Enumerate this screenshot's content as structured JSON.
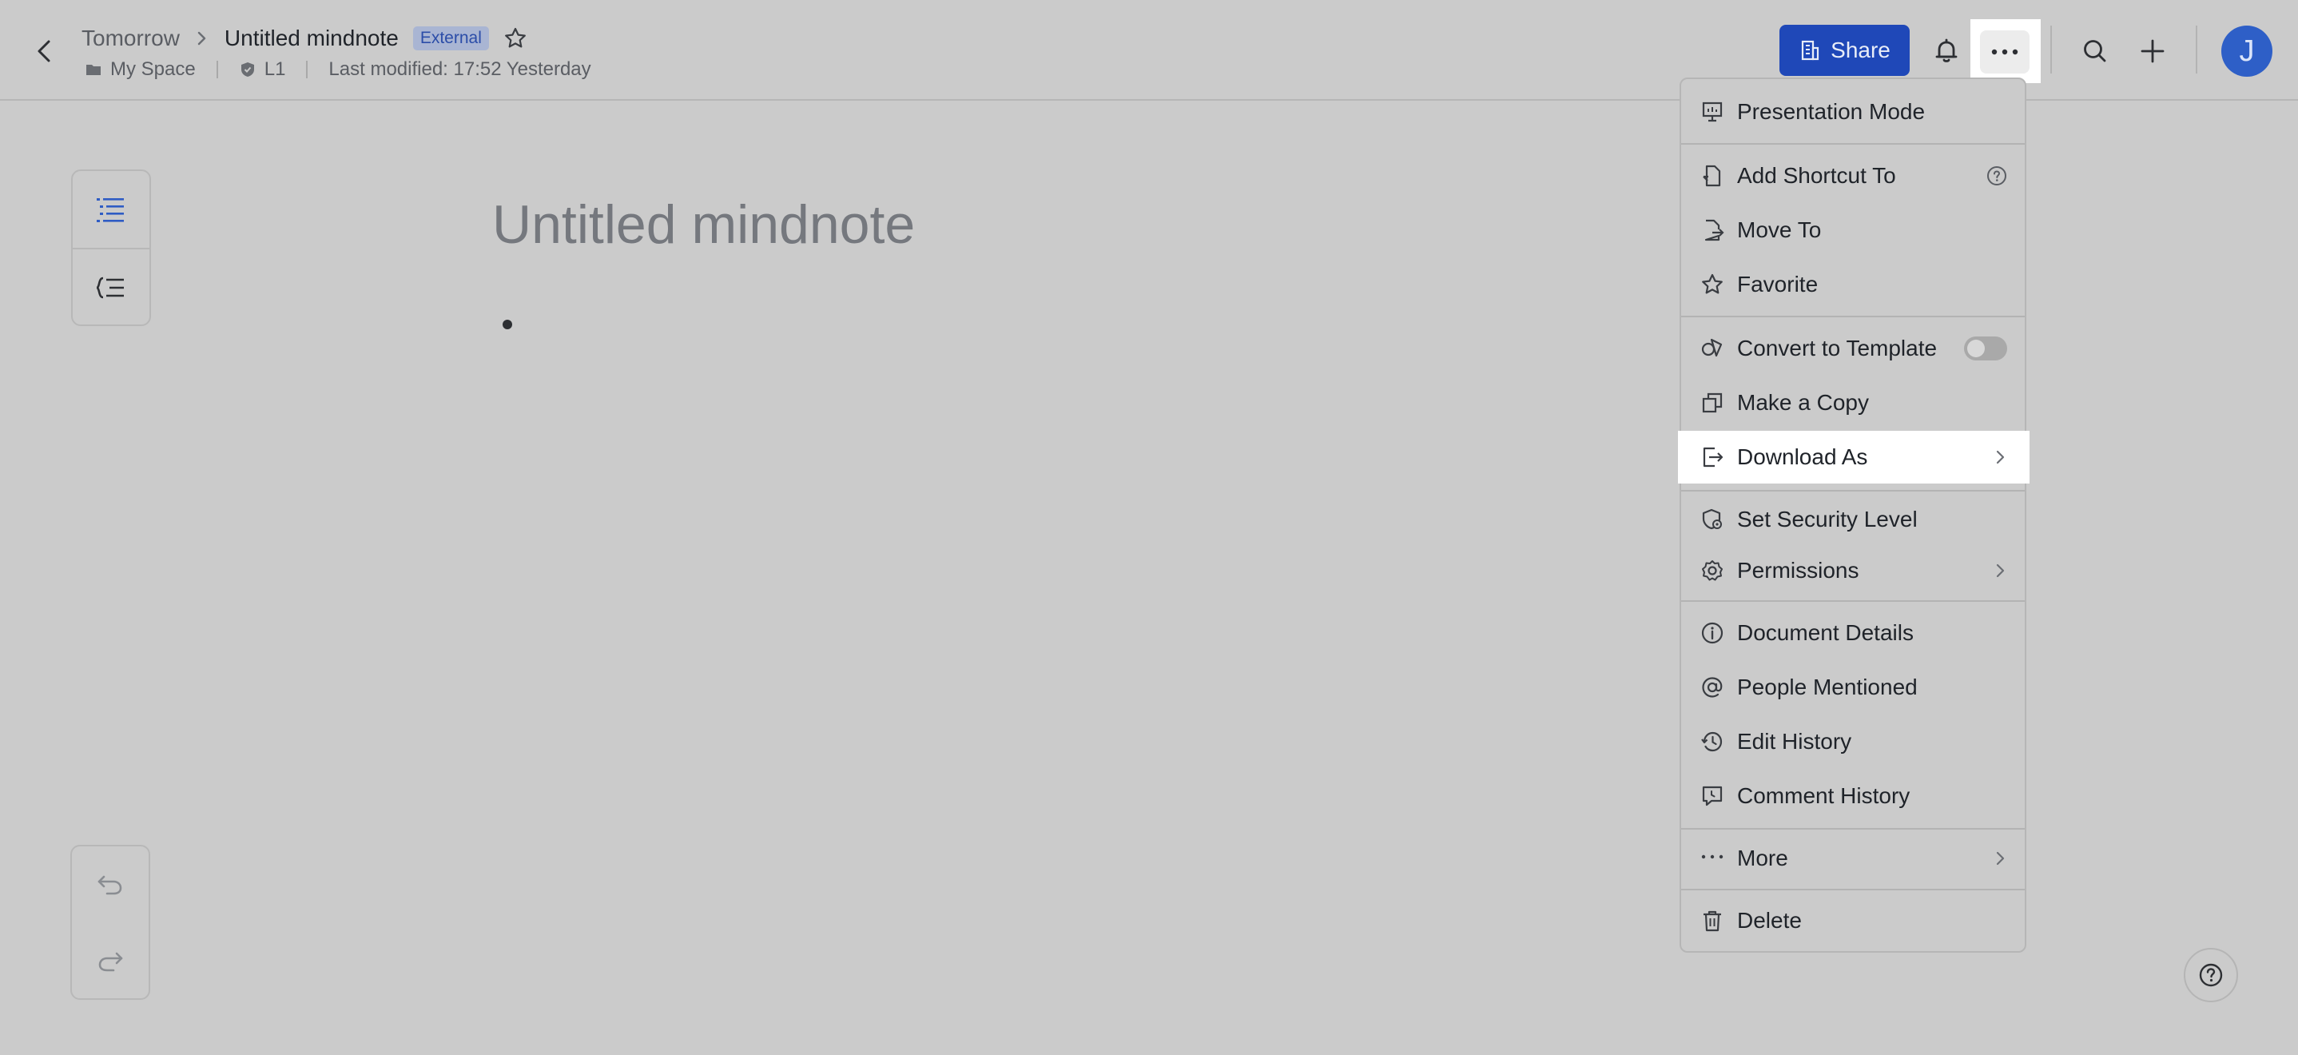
{
  "header": {
    "breadcrumb_parent": "Tomorrow",
    "title": "Untitled mindnote",
    "badge": "External",
    "meta_location": "My Space",
    "meta_security": "L1",
    "meta_modified": "Last modified: 17:52 Yesterday",
    "share_label": "Share",
    "avatar_initial": "J"
  },
  "canvas": {
    "title": "Untitled mindnote"
  },
  "menu": {
    "items": [
      {
        "label": "Presentation Mode",
        "icon": "presentation-icon"
      },
      {
        "label": "Add Shortcut To",
        "icon": "shortcut-icon"
      },
      {
        "label": "Move To",
        "icon": "move-icon"
      },
      {
        "label": "Favorite",
        "icon": "star-icon"
      },
      {
        "label": "Convert to Template",
        "icon": "template-icon"
      },
      {
        "label": "Make a Copy",
        "icon": "copy-icon"
      },
      {
        "label": "Download As",
        "icon": "download-icon"
      },
      {
        "label": "Set Security Level",
        "icon": "security-icon"
      },
      {
        "label": "Permissions",
        "icon": "gear-icon"
      },
      {
        "label": "Document Details",
        "icon": "info-icon"
      },
      {
        "label": "People Mentioned",
        "icon": "at-icon"
      },
      {
        "label": "Edit History",
        "icon": "history-icon"
      },
      {
        "label": "Comment History",
        "icon": "comment-history-icon"
      },
      {
        "label": "More",
        "icon": "ellipsis-icon"
      },
      {
        "label": "Delete",
        "icon": "trash-icon"
      }
    ]
  },
  "colors": {
    "accent": "#1f48b8",
    "background": "#cbcbcb",
    "highlight": "#ffffff"
  }
}
